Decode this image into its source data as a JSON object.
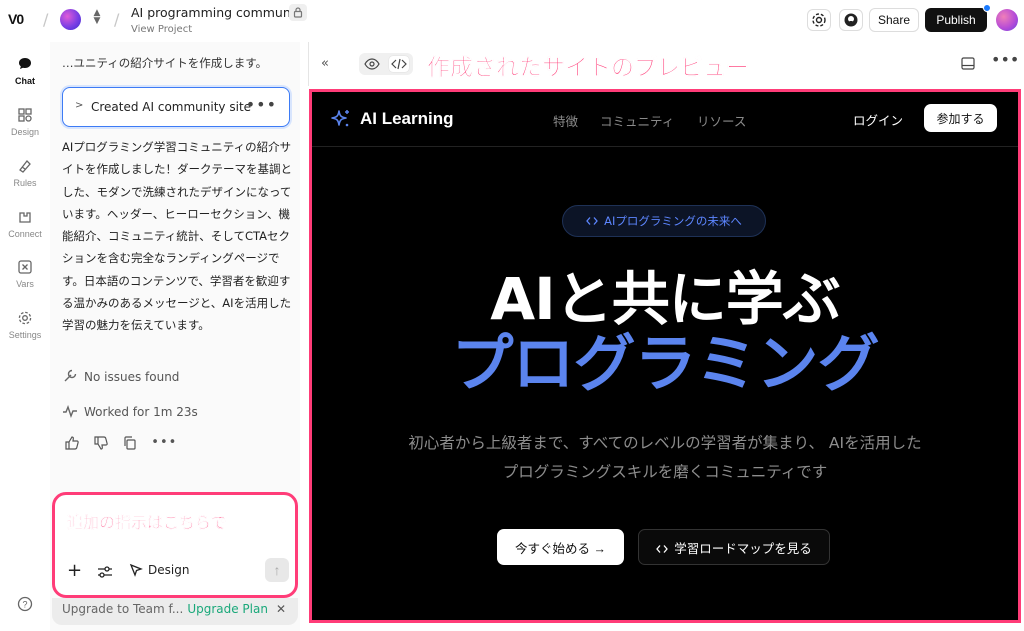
{
  "topbar": {
    "logo": "V0",
    "project_title": "AI programming community",
    "project_sub": "View Project",
    "share": "Share",
    "publish": "Publish"
  },
  "rail": {
    "items": [
      {
        "label": "Chat",
        "icon": "chat-icon"
      },
      {
        "label": "Design",
        "icon": "design-icon"
      },
      {
        "label": "Rules",
        "icon": "rules-icon"
      },
      {
        "label": "Connect",
        "icon": "connect-icon"
      },
      {
        "label": "Vars",
        "icon": "vars-icon"
      },
      {
        "label": "Settings",
        "icon": "settings-icon"
      }
    ]
  },
  "chat": {
    "intro": "…ユニティの紹介サイトを作成します。",
    "action_title": "Created AI community site",
    "reply": "AIプログラミング学習コミュニティの紹介サイトを作成しました！ダークテーマを基調とした、モダンで洗練されたデザインになっています。ヘッダー、ヒーローセクション、機能紹介、コミュニティ統計、そしてCTAセクションを含む完全なランディングページです。日本語のコンテンツで、学習者を歓迎する温かみのあるメッセージと、AIを活用した学習の魅力を伝えています。",
    "no_issues": "No issues found",
    "worked_for": "Worked for 1m 23s",
    "composer_hint": "追加の指示はこちらで",
    "design_tool": "Design",
    "upgrade_text": "Upgrade to Team f...",
    "upgrade_link": "Upgrade Plan"
  },
  "preview": {
    "label": "作成されたサイトのプレビュー"
  },
  "site": {
    "brand": "AI Learning",
    "nav_links": [
      "特徴",
      "コミュニティ",
      "リソース"
    ],
    "login": "ログイン",
    "join": "参加する",
    "badge": "AIプログラミングの未来へ",
    "hero_line1": "AIと共に学ぶ",
    "hero_line2": "プログラミング",
    "hero_sub": "初心者から上級者まで、すべてのレベルの学習者が集まり、 AIを活用したプログラミングスキルを磨くコミュニティです",
    "cta_primary": "今すぐ始める →",
    "cta_secondary": "学習ロードマップを見る"
  },
  "colors": {
    "accent_pink": "#ff3c78",
    "hero_blue": "#5b84ee",
    "badge_blue": "#5d86ff",
    "upgrade_green": "#1aa87a",
    "focus_blue": "#3d7bf5"
  }
}
